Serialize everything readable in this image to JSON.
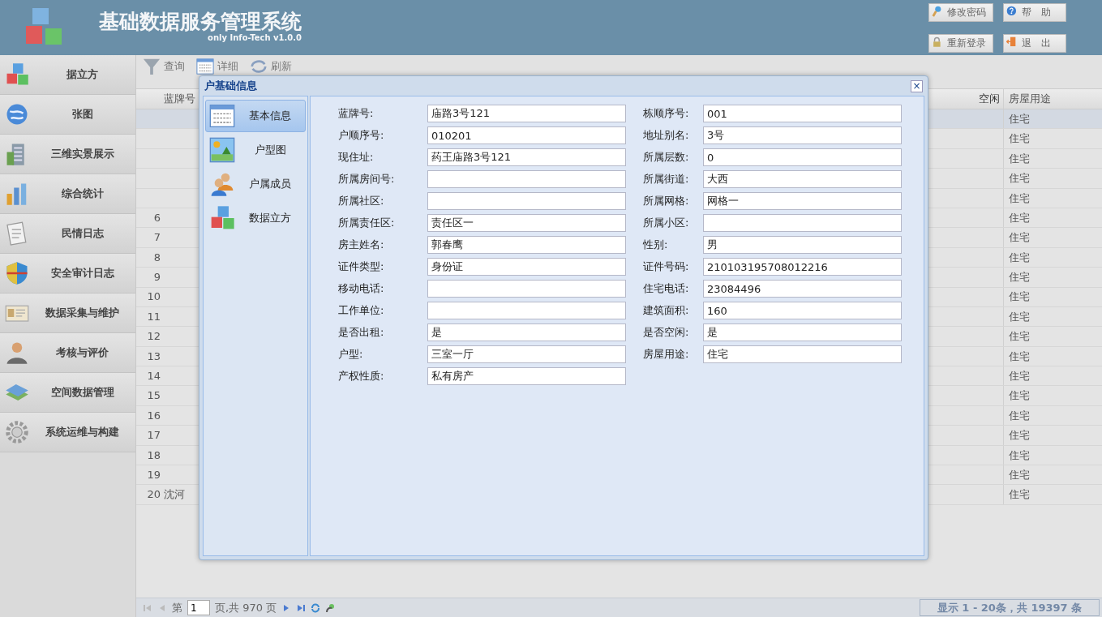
{
  "app": {
    "title": "基础数据服务管理系统",
    "subtitle": "only Info-Tech v1.0.0"
  },
  "header_buttons": [
    {
      "label": "修改密码",
      "kind": "key"
    },
    {
      "label": "帮　助",
      "kind": "help"
    },
    {
      "label": "重新登录",
      "kind": "lock"
    },
    {
      "label": "退　出",
      "kind": "exit"
    }
  ],
  "sidebar": {
    "items": [
      {
        "label": "据立方",
        "kind": "cube"
      },
      {
        "label": "张图",
        "kind": "globe"
      },
      {
        "label": "三维实景展示",
        "kind": "building"
      },
      {
        "label": "综合统计",
        "kind": "chart"
      },
      {
        "label": "民情日志",
        "kind": "note"
      },
      {
        "label": "安全审计日志",
        "kind": "shield"
      },
      {
        "label": "数据采集与维护",
        "kind": "card"
      },
      {
        "label": "考核与评价",
        "kind": "person"
      },
      {
        "label": "空间数据管理",
        "kind": "map"
      },
      {
        "label": "系统运维与构建",
        "kind": "gear"
      }
    ]
  },
  "toolbar": [
    {
      "label": "查询",
      "kind": "filter"
    },
    {
      "label": "详细",
      "kind": "table"
    },
    {
      "label": "刷新",
      "kind": "refresh"
    }
  ],
  "table": {
    "columns": [
      "蓝牌号",
      "空闲",
      "房屋用途"
    ],
    "rows": [
      {
        "use": "住宅",
        "selected": true
      },
      {
        "use": "住宅",
        "selected": false
      },
      {
        "use": "住宅",
        "selected": false
      },
      {
        "use": "住宅",
        "selected": false
      },
      {
        "use": "住宅",
        "selected": false
      },
      {
        "number": "6",
        "use": "住宅",
        "selected": false
      },
      {
        "number": "7",
        "use": "住宅",
        "selected": false
      },
      {
        "number": "8",
        "use": "住宅",
        "selected": false
      },
      {
        "number": "9",
        "use": "住宅",
        "selected": false
      },
      {
        "number": "10",
        "use": "住宅",
        "selected": false
      },
      {
        "number": "11",
        "use": "住宅",
        "selected": false
      },
      {
        "number": "12",
        "use": "住宅",
        "selected": false
      },
      {
        "number": "13",
        "use": "住宅",
        "selected": false
      },
      {
        "number": "14",
        "use": "住宅",
        "selected": false
      },
      {
        "number": "15",
        "use": "住宅",
        "selected": false
      },
      {
        "number": "16",
        "use": "住宅",
        "selected": false
      },
      {
        "number": "17",
        "use": "住宅",
        "selected": false
      },
      {
        "number": "18",
        "use": "住宅",
        "selected": false
      },
      {
        "number": "19",
        "use": "住宅",
        "selected": false
      },
      {
        "number": "20",
        "cell": "沈河",
        "use": "住宅",
        "selected": false
      }
    ]
  },
  "pager": {
    "page_label": "第",
    "page": "1",
    "total": "页,共 970 页",
    "summary": "显示 1 - 20条，共 19397 条"
  },
  "dialog": {
    "title": "户基础信息",
    "close": "×",
    "tabs": [
      {
        "label": "基本信息",
        "kind": "table",
        "selected": true
      },
      {
        "label": "户型图",
        "kind": "picture",
        "selected": false
      },
      {
        "label": "户属成员",
        "kind": "people",
        "selected": false
      },
      {
        "label": "数据立方",
        "kind": "cube",
        "selected": false
      }
    ],
    "fields": [
      {
        "label": "蓝牌号:",
        "value": "庙路3号121"
      },
      {
        "label": "栋顺序号:",
        "value": "001"
      },
      {
        "label": "户顺序号:",
        "value": "010201"
      },
      {
        "label": "地址别名:",
        "value": "3号"
      },
      {
        "label": "现住址:",
        "value": "药王庙路3号121"
      },
      {
        "label": "所属层数:",
        "value": "0"
      },
      {
        "label": "所属房间号:"
      },
      {
        "label": "所属街道:",
        "value": "大西"
      },
      {
        "label": "所属社区:"
      },
      {
        "label": "所属网格:",
        "value": "网格一"
      },
      {
        "label": "所属责任区:",
        "value": "责任区一"
      },
      {
        "label": "所属小区:"
      },
      {
        "label": "房主姓名:",
        "value": "郭春鹰"
      },
      {
        "label": "性别:",
        "value": "男"
      },
      {
        "label": "证件类型:",
        "value": "身份证"
      },
      {
        "label": "证件号码:",
        "value": "210103195708012216"
      },
      {
        "label": "移动电话:"
      },
      {
        "label": "住宅电话:",
        "value": "23084496"
      },
      {
        "label": "工作单位:"
      },
      {
        "label": "建筑面积:",
        "value": "160"
      },
      {
        "label": "是否出租:",
        "value": "是"
      },
      {
        "label": "是否空闲:",
        "value": "是"
      },
      {
        "label": "户型:",
        "value": "三室一厅"
      },
      {
        "label": "房屋用途:",
        "value": "住宅"
      },
      {
        "label": "产权性质:",
        "value": "私有房产"
      }
    ]
  }
}
